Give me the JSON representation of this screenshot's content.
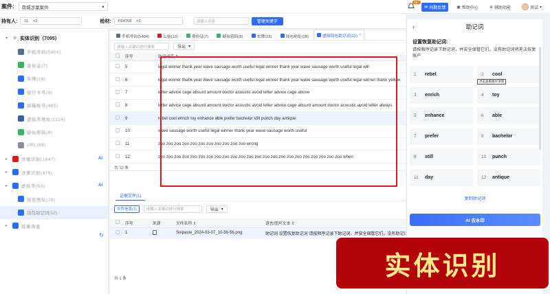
{
  "header": {
    "case_label": "案件:",
    "case_value": "南城涉案案件",
    "notification_badge": "99+",
    "buttons": [
      "问题反馈",
      "帮助中心",
      "辅助功能"
    ],
    "user": "测试"
  },
  "filters": {
    "holder_label": "持有人:",
    "holder_value": "11",
    "holder_extra": "+3",
    "material_label": "检材:",
    "material_value": "PE6708",
    "material_extra": "+3",
    "search_placeholder": "请输入内容",
    "manage_button": "管理关键字"
  },
  "sidebar": {
    "root_label": "实体识别（7095）",
    "items": [
      {
        "label": "手机号码(5404)",
        "color": "#5a6c8a",
        "icon": "phone-icon",
        "child": true
      },
      {
        "label": "身份证(7)",
        "color": "#3bb36a",
        "icon": "id-card-icon",
        "child": true
      },
      {
        "label": "车牌(18)",
        "color": "#2d6cf6",
        "icon": "car-icon",
        "child": true
      },
      {
        "label": "银行卡号(9)",
        "color": "#2d6cf6",
        "icon": "bank-card-icon",
        "child": true
      },
      {
        "label": "邮箱账号(465)",
        "color": "#2d6cf6",
        "icon": "mail-icon",
        "child": true
      },
      {
        "label": "虚拟币地址(1114)",
        "color": "#3a5fa8",
        "icon": "btc-icon",
        "child": true
      },
      {
        "label": "疑似密码(8)",
        "color": "#3bb36a",
        "icon": "lock-icon",
        "child": true
      },
      {
        "label": "URL(66)",
        "color": "#8a8f99",
        "icon": "link-icon",
        "child": true
      },
      {
        "label": "涉赌识别(1647)",
        "color": "#e0161f",
        "icon": "dice-icon",
        "child": false,
        "ai": "AI"
      },
      {
        "label": "涉黄识别(476)",
        "color": "#2d6cf6",
        "icon": "image-icon",
        "child": false
      },
      {
        "label": "虚拟币(53)",
        "color": "#2d6cf6",
        "icon": "coin-icon",
        "child": false,
        "ai": "AI"
      },
      {
        "label": "钱包地址(28)",
        "color": "#2d6cf6",
        "icon": "wallet-icon",
        "child": true
      },
      {
        "label": "钱包助记词(12)",
        "color": "#2d6cf6",
        "icon": "key-icon",
        "child": true,
        "active": true
      },
      {
        "label": "结果筛查",
        "color": "#2d6cf6",
        "icon": "filter-icon",
        "child": false
      }
    ]
  },
  "main": {
    "tabs": [
      {
        "label": "手机号码(5404)",
        "color": "#5a6c8a"
      },
      {
        "label": "公益(13)",
        "color": "#e0161f"
      },
      {
        "label": "身份证(7)",
        "color": "#3bb36a"
      },
      {
        "label": "疑似密码(8)",
        "color": "#3bb36a"
      },
      {
        "label": "车牌(18)",
        "color": "#2d6cf6"
      },
      {
        "label": "钱包地址(28)",
        "color": "#2d6cf6"
      },
      {
        "label": "虚拟钱包助记词(12)",
        "color": "#2d6cf6",
        "active": true
      }
    ],
    "search_placeholder": "请输入关键词进行搜索",
    "export_label": "导出",
    "columns": [
      "序号",
      "助记词字 ⇕"
    ],
    "rows": [
      {
        "no": "5",
        "text": "legal winner thank year wave sausage worth useful legal winner thank year wave sausage worth useful legal will"
      },
      {
        "no": "6",
        "text": "legal winner thank year wave sausage worth useful legal winner thank year wave sausage worth useful legal winner thank yellow"
      },
      {
        "no": "7",
        "text": "letter advice cage absurd amount doctor acoustic avoid letter advice cage above"
      },
      {
        "no": "8",
        "text": "letter advice cage absurd amount doctor acoustic avoid letter advice cage absurd amount doctor acoustic avoid letter always"
      },
      {
        "no": "9",
        "text": "rebel cool enrich toy enhance able prefer bachelor still punch day antique",
        "highlight": true
      },
      {
        "no": "10",
        "text": "wave sausage worth useful legal winner thank year wave sausage worth useful"
      },
      {
        "no": "11",
        "text": "zoo zoo zoo zoo zoo zoo zoo zoo zoo zoo zoo wrong"
      },
      {
        "no": "12",
        "text": "zoo zoo zoo zoo zoo zoo zoo zoo zoo zoo zoo zoo zoo zoo zoo zoo zoo zoo zoo zoo zoo zoo zoo when"
      }
    ],
    "total": "共 12 条"
  },
  "evidence": {
    "tab_label": "证据文件(1)",
    "file_info_btn": "文件信息(1)",
    "search_placeholder": "请输入关键词进行搜索",
    "export_label": "导出",
    "columns": [
      "序号",
      "来源",
      "文件名称 ⇕",
      "语言/图片文本 ⇕"
    ],
    "rows": [
      {
        "no": "1",
        "name": "Snipaste_2024-03-07_10-56-56.png",
        "text": "助记词 设置恢复助记词 请按顺序记录下助记词，并安全保管它们。没有助记词将无法恢复账户 rebel cool enrich toy"
      }
    ],
    "total": "共 1 条"
  },
  "right_panel": {
    "title": "助记词",
    "subtitle": "设置恢复助记词:",
    "desc": "请按顺序记录下助记词，并安全保管它们。没有助记词将无法恢复账户",
    "words": [
      {
        "n": "1",
        "w": "rebel"
      },
      {
        "n": "2",
        "w": "cool"
      },
      {
        "n": "3",
        "w": "enrich"
      },
      {
        "n": "4",
        "w": "toy"
      },
      {
        "n": "5",
        "w": "enhance"
      },
      {
        "n": "6",
        "w": "able"
      },
      {
        "n": "7",
        "w": "prefer"
      },
      {
        "n": "8",
        "w": "bachelor"
      },
      {
        "n": "9",
        "w": "still"
      },
      {
        "n": "10",
        "w": "punch"
      },
      {
        "n": "11",
        "w": "day"
      },
      {
        "n": "12",
        "w": "antique"
      }
    ],
    "tooltip": "点击查看图片详情",
    "copy_link": "复制助记词",
    "ai_button": "AI 去水印"
  },
  "overlay": {
    "title": "实体识别"
  }
}
